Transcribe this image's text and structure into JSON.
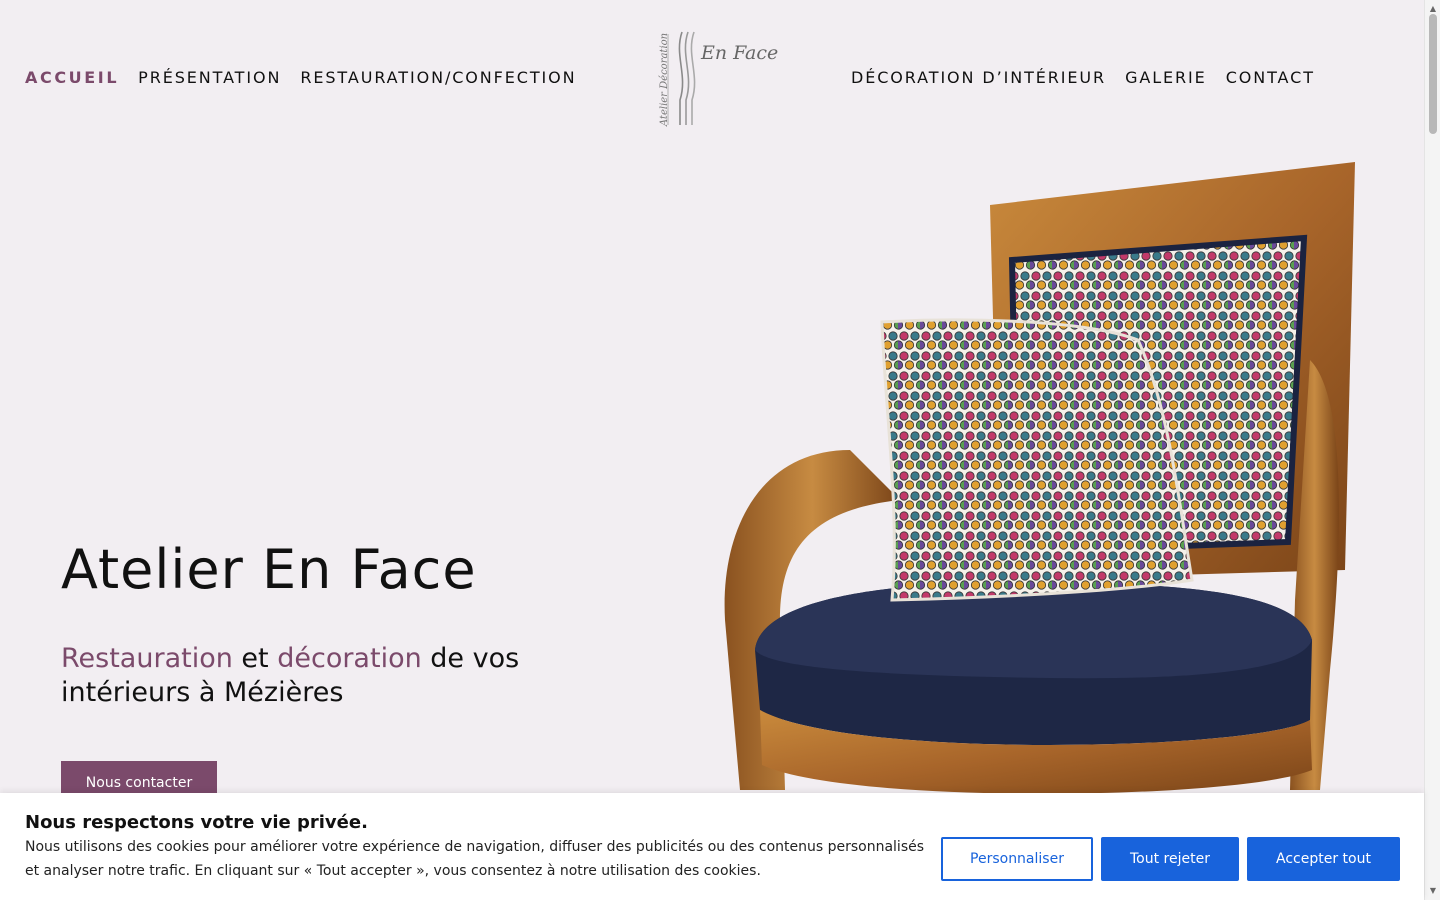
{
  "nav": {
    "left": [
      {
        "label": "ACCUEIL",
        "active": true
      },
      {
        "label": "PRÉSENTATION",
        "active": false
      },
      {
        "label": "RESTAURATION/CONFECTION",
        "active": false
      }
    ],
    "right": [
      {
        "label": "DÉCORATION D’INTÉRIEUR",
        "active": false
      },
      {
        "label": "GALERIE",
        "active": false
      },
      {
        "label": "CONTACT",
        "active": false
      }
    ]
  },
  "logo": {
    "brand": "En Face",
    "sub": "Atelier Décoration"
  },
  "hero": {
    "title": "Atelier En Face",
    "subtitle": {
      "accent1": "Restauration",
      "mid": " et ",
      "accent2": "décoration",
      "rest": " de vos intérieurs à Mézières"
    },
    "cta_label": "Nous contacter",
    "image_icon": "armchair-with-cushion-photo"
  },
  "cookie": {
    "title": "Nous respectons votre vie privée.",
    "text": "Nous utilisons des cookies pour améliorer votre expérience de navigation, diffuser des publicités ou des contenus personnalisés et analyser notre trafic. En cliquant sur « Tout accepter », vous consentez à notre utilisation des cookies.",
    "customize": "Personnaliser",
    "reject": "Tout rejeter",
    "accept": "Accepter tout"
  },
  "colors": {
    "accent": "#7b4a6b",
    "background": "#f2eef2",
    "cookie_button": "#1863dc"
  },
  "scrollbar": {
    "up_icon": "▲",
    "down_icon": "▼"
  }
}
